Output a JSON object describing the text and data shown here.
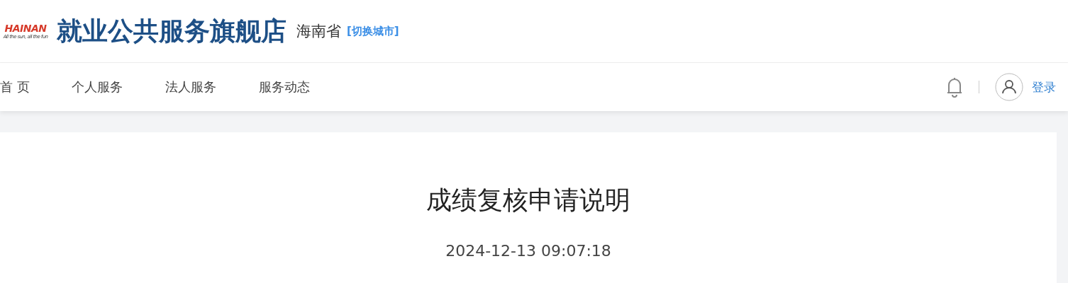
{
  "header": {
    "logo": {
      "wordmark": "HAINAN",
      "tagline": "All the sun, all the fun"
    },
    "title": "就业公共服务旗舰店",
    "province": "海南省",
    "switch_city": "[切换城市]"
  },
  "nav": {
    "items": [
      "首 页",
      "个人服务",
      "法人服务",
      "服务动态"
    ],
    "login": "登录"
  },
  "article": {
    "title": "成绩复核申请说明",
    "date": "2024-12-13 09:07:18"
  }
}
